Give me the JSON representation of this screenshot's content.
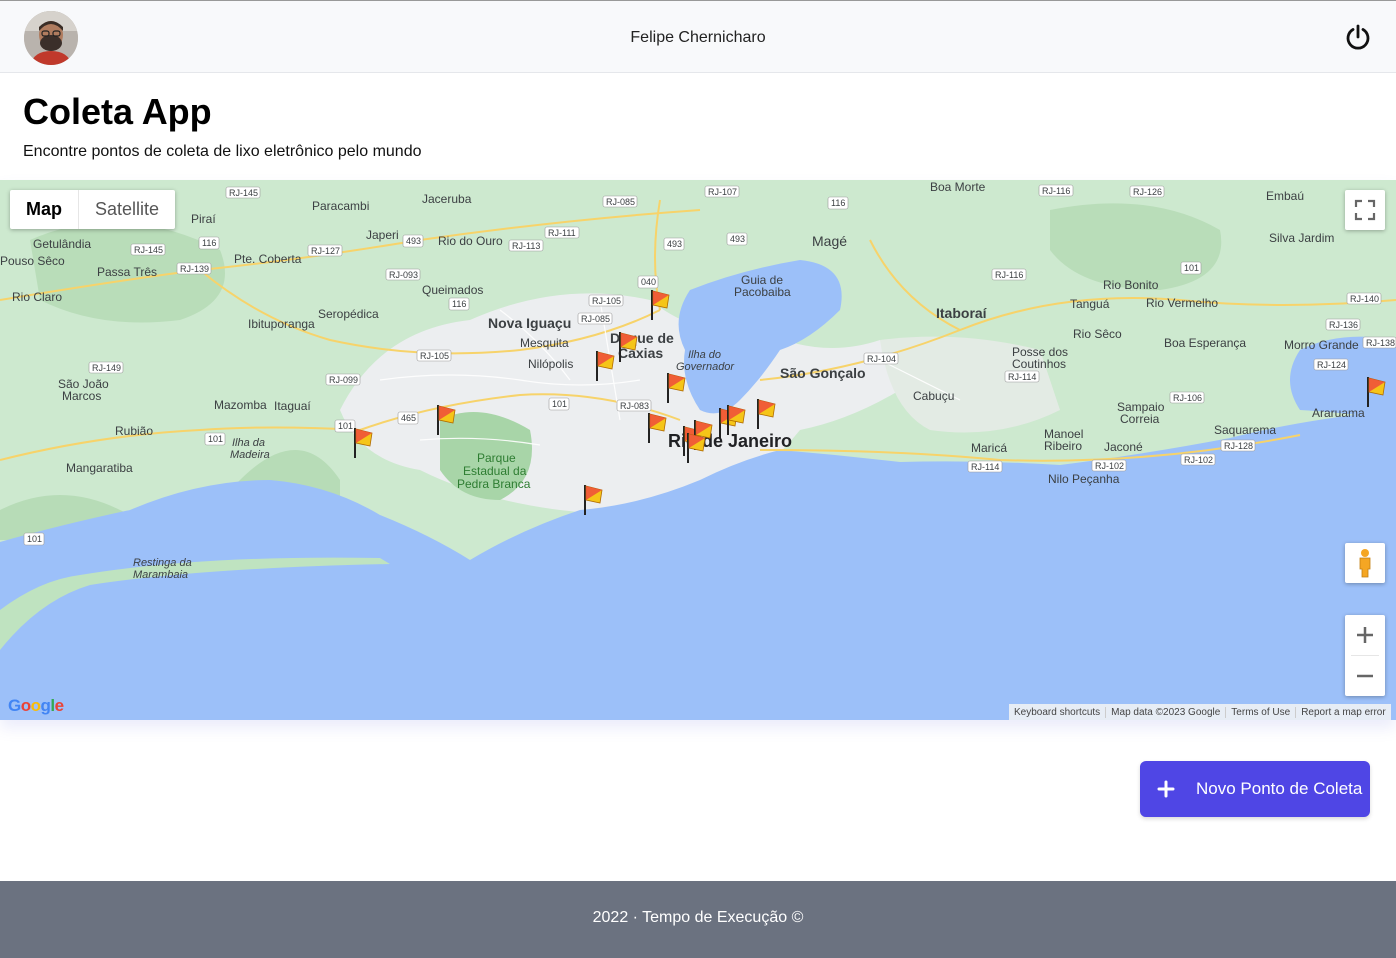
{
  "header": {
    "username": "Felipe Chernicharo",
    "avatar_icon": "avatar-photo",
    "logout_icon": "power-icon"
  },
  "page": {
    "title": "Coleta App",
    "subtitle": "Encontre pontos de coleta de lixo eletrônico pelo mundo"
  },
  "map": {
    "type_controls": {
      "map": "Map",
      "satellite": "Satellite",
      "selected": "Map"
    },
    "place_labels": [
      "Boa Morte",
      "Embaú",
      "Paracambi",
      "Piraí",
      "Japeri",
      "Rio do Ouro",
      "Magé",
      "Getulândia",
      "Pouso Sêco",
      "Passa Três",
      "Pte. Coberta",
      "Silva Jardim",
      "Rio Claro",
      "Queimados",
      "Guia de Pacobaiba",
      "Tanguá",
      "Rio Bonito",
      "Rio Vermelho",
      "Ibituporanga",
      "Seropédica",
      "Nova Iguaçu",
      "Duque de Caxias",
      "Itaboraí",
      "Mesquita",
      "Rio Sêco",
      "Boa Esperança",
      "Morro Grande",
      "Nilópolis",
      "Ilha do Governador",
      "Posse dos Coutinhos",
      "São João Marcos",
      "São Gonçalo",
      "Mazomba",
      "Itaguaí",
      "Cabuçu",
      "Sampaio Correia",
      "Araruama",
      "Rubião",
      "Ilha da Madeira",
      "Rio de Janeiro",
      "Saquarema",
      "Manoel Ribeiro",
      "Jaconé",
      "Maricá",
      "Mangaratiba",
      "Parque Estadual da Pedra Branca",
      "Nilo Peçanha",
      "Restinga da Marambaia",
      "Jaceruba"
    ],
    "road_labels": [
      "RJ-145",
      "RJ-085",
      "RJ-107",
      "RJ-116",
      "RJ-126",
      "116",
      "RJ-111",
      "493",
      "RJ-113",
      "RJ-127",
      "RJ-139",
      "RJ-093",
      "040",
      "RJ-105",
      "RJ-116",
      "101",
      "RJ-140",
      "RJ-136",
      "RJ-138",
      "RJ-149",
      "RJ-105",
      "RJ-104",
      "RJ-124",
      "RJ-099",
      "RJ-114",
      "RJ-083",
      "RJ-106",
      "465",
      "101",
      "RJ-128",
      "RJ-102",
      "RJ-114",
      "RJ-102",
      "101"
    ],
    "marker_icon": "collection-point-flag-icon",
    "marker_count": 15,
    "attribution": [
      "Keyboard shortcuts",
      "Map data ©2023 Google",
      "Terms of Use",
      "Report a map error"
    ],
    "logo": "Google"
  },
  "actions": {
    "new_point_label": "Novo Ponto de Coleta"
  },
  "footer": {
    "text": "2022 · Tempo de Execução ©"
  }
}
